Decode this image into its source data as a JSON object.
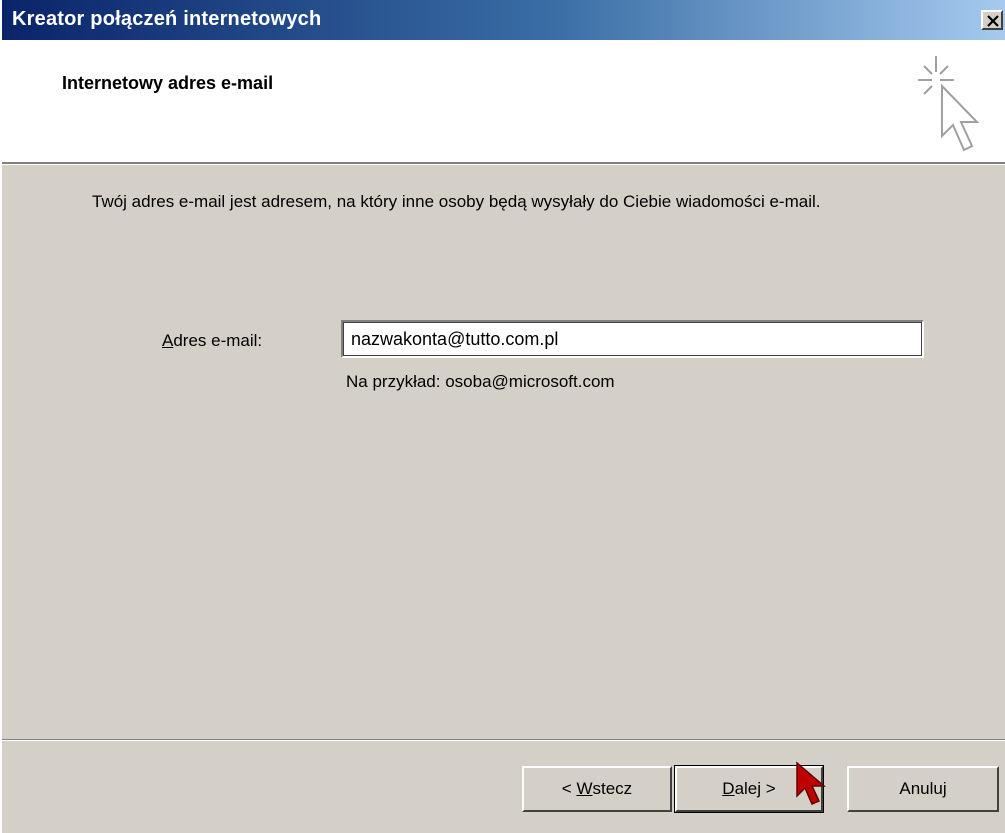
{
  "window": {
    "title": "Kreator połączeń internetowych",
    "close_label": "×"
  },
  "header": {
    "title": "Internetowy adres e-mail",
    "icon": "wizard-cursor-sparkle-icon"
  },
  "body": {
    "description": "Twój adres e-mail jest adresem, na który inne osoby będą wysyłały do Ciebie wiadomości e-mail.",
    "email_label_prefix": "A",
    "email_label_rest": "dres e-mail:",
    "email_value": "nazwakonta@tutto.com.pl",
    "email_example": "Na przykład: osoba@microsoft.com"
  },
  "buttons": {
    "back_prefix": "< ",
    "back_accel": "W",
    "back_rest": "stecz",
    "next_accel": "D",
    "next_rest": "alej >",
    "cancel": "Anuluj"
  },
  "colors": {
    "titlebar_start": "#0a246a",
    "titlebar_end": "#a6caf0",
    "face": "#d4d0c8",
    "cursor_red": "#c00000"
  }
}
